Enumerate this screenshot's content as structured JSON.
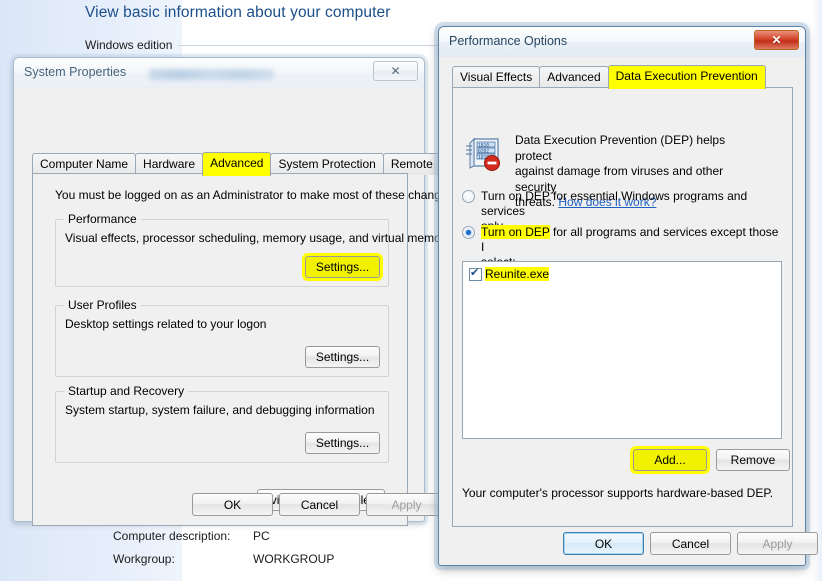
{
  "background": {
    "heading": "View basic information about your computer",
    "section_label": "Windows edition",
    "fields": [
      {
        "label": "Computer description:",
        "value": "PC"
      },
      {
        "label": "Workgroup:",
        "value": "WORKGROUP"
      }
    ]
  },
  "system_properties": {
    "title": "System Properties",
    "close_icon": "close-icon",
    "tabs": [
      {
        "label": "Computer Name",
        "selected": false,
        "highlighted": false
      },
      {
        "label": "Hardware",
        "selected": false,
        "highlighted": false
      },
      {
        "label": "Advanced",
        "selected": true,
        "highlighted": true
      },
      {
        "label": "System Protection",
        "selected": false,
        "highlighted": false
      },
      {
        "label": "Remote",
        "selected": false,
        "highlighted": false
      }
    ],
    "admin_notice": "You must be logged on as an Administrator to make most of these changes.",
    "groups": [
      {
        "title": "Performance",
        "description": "Visual effects, processor scheduling, memory usage, and virtual memory",
        "button": "Settings...",
        "button_highlighted": true
      },
      {
        "title": "User Profiles",
        "description": "Desktop settings related to your logon",
        "button": "Settings...",
        "button_highlighted": false
      },
      {
        "title": "Startup and Recovery",
        "description": "System startup, system failure, and debugging information",
        "button": "Settings...",
        "button_highlighted": false
      }
    ],
    "env_button": "Environment Variables...",
    "footer": {
      "ok": "OK",
      "cancel": "Cancel",
      "apply": "Apply"
    }
  },
  "performance_options": {
    "title": "Performance Options",
    "close_icon": "close-icon",
    "tabs": [
      {
        "label": "Visual Effects",
        "selected": false,
        "highlighted": false
      },
      {
        "label": "Advanced",
        "selected": false,
        "highlighted": false
      },
      {
        "label": "Data Execution Prevention",
        "selected": true,
        "highlighted": true
      }
    ],
    "icon_name": "dep-shield-icon",
    "description_line1": "Data Execution Prevention (DEP) helps protect",
    "description_line2": "against damage from viruses and other security",
    "description_line3_prefix": "threats. ",
    "description_link": "How does it work?",
    "radios": [
      {
        "name": "dep-essential-only",
        "selected": false,
        "line1": "Turn on DEP for essential Windows programs and services",
        "line2": "only",
        "highlight_text": ""
      },
      {
        "name": "dep-all-except",
        "selected": true,
        "line1_highlighted": "Turn on DEP",
        "line1_rest": " for all programs and services except those I",
        "line2": "select:"
      }
    ],
    "exception_list": [
      {
        "label": "Reunite.exe",
        "checked": true,
        "highlighted": true
      }
    ],
    "add_button": "Add...",
    "add_button_highlighted": true,
    "remove_button": "Remove",
    "processor_status": "Your computer's processor supports hardware-based DEP.",
    "footer": {
      "ok": "OK",
      "cancel": "Cancel",
      "apply": "Apply"
    }
  },
  "colors": {
    "highlight": "#ffff00",
    "link": "#1f5fbd",
    "heading": "#1a4f8a",
    "close_red": "#c32d17"
  }
}
